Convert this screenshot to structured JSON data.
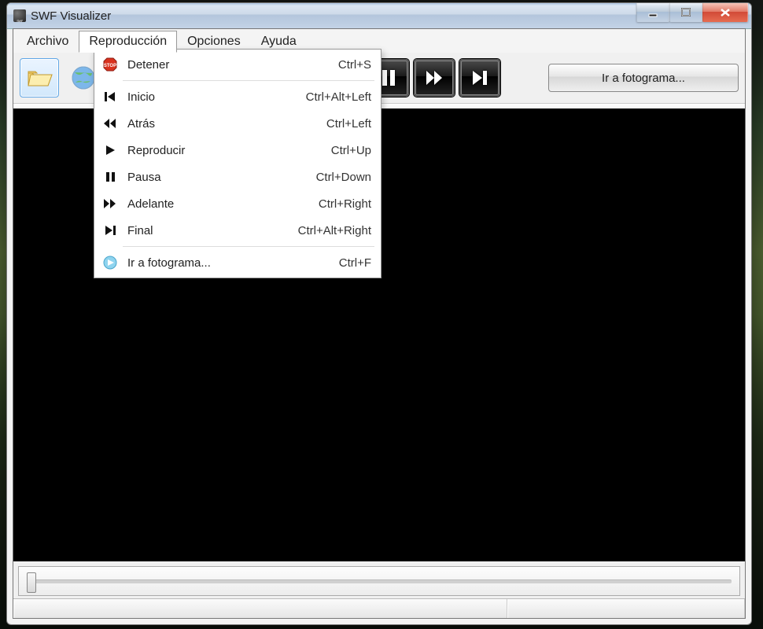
{
  "title": "SWF Visualizer",
  "menubar": {
    "file": "Archivo",
    "playback": "Reproducción",
    "options": "Opciones",
    "help": "Ayuda"
  },
  "toolbar": {
    "goto_label": "Ir a fotograma..."
  },
  "dropdown": {
    "stop": {
      "label": "Detener",
      "shortcut": "Ctrl+S"
    },
    "first": {
      "label": "Inicio",
      "shortcut": "Ctrl+Alt+Left"
    },
    "back": {
      "label": "Atrás",
      "shortcut": "Ctrl+Left"
    },
    "play": {
      "label": "Reproducir",
      "shortcut": "Ctrl+Up"
    },
    "pause": {
      "label": "Pausa",
      "shortcut": "Ctrl+Down"
    },
    "forward": {
      "label": "Adelante",
      "shortcut": "Ctrl+Right"
    },
    "last": {
      "label": "Final",
      "shortcut": "Ctrl+Alt+Right"
    },
    "goto": {
      "label": "Ir a fotograma...",
      "shortcut": "Ctrl+F"
    }
  }
}
